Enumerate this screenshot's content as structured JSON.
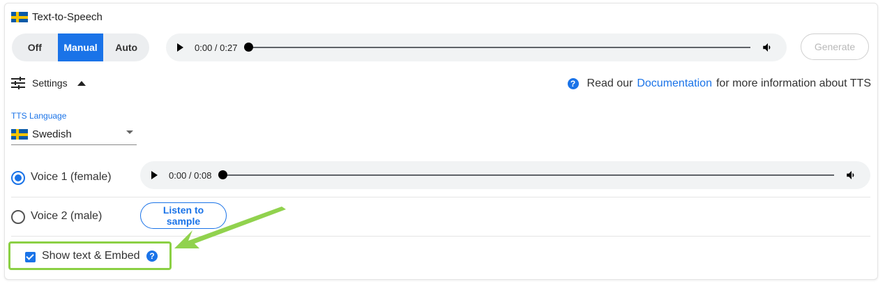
{
  "header": {
    "title": "Text-to-Speech",
    "flag_icon": "sweden-flag-icon"
  },
  "mode": {
    "options": [
      "Off",
      "Manual",
      "Auto"
    ],
    "selected": "Manual"
  },
  "main_player": {
    "time": "0:00 / 0:27",
    "progress": 0
  },
  "generate_label": "Generate",
  "settings": {
    "label": "Settings",
    "expanded": true
  },
  "docs": {
    "prefix": "Read our ",
    "link": "Documentation",
    "suffix": " for more information about TTS"
  },
  "language": {
    "label": "TTS Language",
    "value": "Swedish"
  },
  "voices": [
    {
      "label": "Voice 1 (female)",
      "selected": true,
      "player_time": "0:00 / 0:08"
    },
    {
      "label": "Voice 2 (male)",
      "selected": false,
      "sample_label": "Listen to sample"
    }
  ],
  "embed": {
    "label": "Show text & Embed",
    "checked": true
  },
  "colors": {
    "accent": "#1a73e8",
    "highlight": "#8bd044"
  }
}
